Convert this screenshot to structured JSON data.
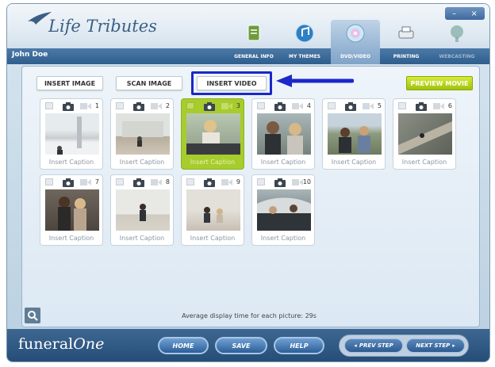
{
  "app": {
    "logo_text": "Life Tributes",
    "user_name": "John Doe"
  },
  "window_controls": {
    "minimize": "–",
    "close": "×"
  },
  "nav": {
    "tabs": [
      {
        "label": "GENERAL INFO",
        "icon": "document-pencil-icon",
        "state": "normal"
      },
      {
        "label": "MY THEMES",
        "icon": "music-note-icon",
        "state": "normal"
      },
      {
        "label": "DVD/VIDEO",
        "icon": "disc-icon",
        "state": "active"
      },
      {
        "label": "PRINTING",
        "icon": "printer-icon",
        "state": "normal"
      },
      {
        "label": "WEBCASTING",
        "icon": "webcast-icon",
        "state": "disabled"
      }
    ]
  },
  "toolbar": {
    "insert_image": "INSERT IMAGE",
    "scan_image": "SCAN IMAGE",
    "insert_video": "INSERT VIDEO",
    "preview_movie": "PREVIEW MOVIE"
  },
  "cards": [
    {
      "number": "1",
      "caption": "Insert Caption",
      "selected": false
    },
    {
      "number": "2",
      "caption": "Insert Caption",
      "selected": false
    },
    {
      "number": "3",
      "caption": "Insert Caption",
      "selected": true
    },
    {
      "number": "4",
      "caption": "Insert Caption",
      "selected": false
    },
    {
      "number": "5",
      "caption": "Insert Caption",
      "selected": false
    },
    {
      "number": "6",
      "caption": "Insert Caption",
      "selected": false
    },
    {
      "number": "7",
      "caption": "Insert Caption",
      "selected": false
    },
    {
      "number": "8",
      "caption": "Insert Caption",
      "selected": false
    },
    {
      "number": "9",
      "caption": "Insert Caption",
      "selected": false
    },
    {
      "number": "10",
      "caption": "Insert Caption",
      "selected": false
    }
  ],
  "status": {
    "display_time": "Average display time for each picture: 29s"
  },
  "footer": {
    "brand_main": "funeral",
    "brand_one": "One",
    "home": "HOME",
    "save": "SAVE",
    "help": "HELP",
    "prev_step": "PREV STEP",
    "next_step": "NEXT STEP"
  },
  "colors": {
    "accent_green": "#a7cc2d",
    "highlight_blue": "#1b27c9",
    "nav_blue": "#2f5d8c"
  }
}
